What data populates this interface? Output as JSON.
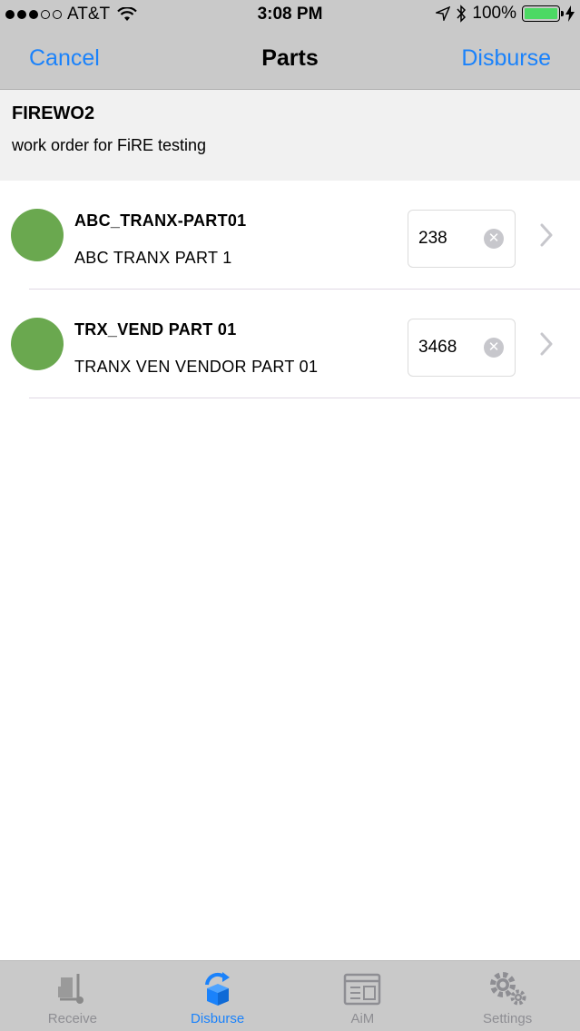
{
  "status": {
    "carrier": "AT&T",
    "time": "3:08 PM",
    "battery": "100%"
  },
  "nav": {
    "cancel": "Cancel",
    "title": "Parts",
    "disburse": "Disburse"
  },
  "work_order": {
    "number": "FIREWO2",
    "description": "work order for FiRE testing"
  },
  "parts": [
    {
      "id": "ABC_TRANX-PART01",
      "name": "ABC TRANX PART 1",
      "quantity": "238"
    },
    {
      "id": "TRX_VEND PART 01",
      "name": "TRANX VEN VENDOR PART 01",
      "quantity": "3468"
    }
  ],
  "tabs": [
    {
      "label": "Receive",
      "icon": "dolly-icon"
    },
    {
      "label": "Disburse",
      "icon": "disburse-box-icon",
      "active": true
    },
    {
      "label": "AiM",
      "icon": "window-icon"
    },
    {
      "label": "Settings",
      "icon": "gears-icon"
    }
  ],
  "colors": {
    "accent": "#1a82fb",
    "status_dot": "#6aa84f",
    "bar_background": "#c9c9c9"
  }
}
